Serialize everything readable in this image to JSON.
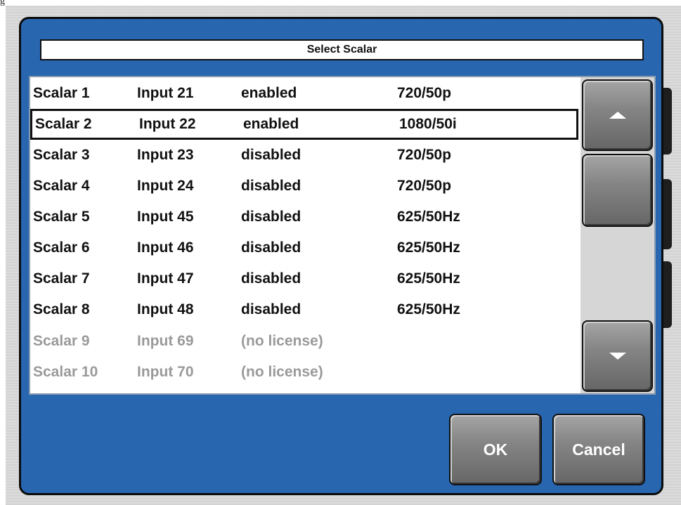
{
  "page_label": "g",
  "dialog": {
    "title": "Select Scalar",
    "rows": [
      {
        "name": "Scalar 1",
        "input": "Input 21",
        "status": "enabled",
        "format": "720/50p",
        "selected": false,
        "licensed": true
      },
      {
        "name": "Scalar 2",
        "input": "Input 22",
        "status": "enabled",
        "format": "1080/50i",
        "selected": true,
        "licensed": true
      },
      {
        "name": "Scalar 3",
        "input": "Input 23",
        "status": "disabled",
        "format": "720/50p",
        "selected": false,
        "licensed": true
      },
      {
        "name": "Scalar 4",
        "input": "Input 24",
        "status": "disabled",
        "format": "720/50p",
        "selected": false,
        "licensed": true
      },
      {
        "name": "Scalar 5",
        "input": "Input 45",
        "status": "disabled",
        "format": "625/50Hz",
        "selected": false,
        "licensed": true
      },
      {
        "name": "Scalar 6",
        "input": "Input 46",
        "status": "disabled",
        "format": "625/50Hz",
        "selected": false,
        "licensed": true
      },
      {
        "name": "Scalar 7",
        "input": "Input 47",
        "status": "disabled",
        "format": "625/50Hz",
        "selected": false,
        "licensed": true
      },
      {
        "name": "Scalar 8",
        "input": "Input 48",
        "status": "disabled",
        "format": "625/50Hz",
        "selected": false,
        "licensed": true
      },
      {
        "name": "Scalar 9",
        "input": "Input 69",
        "status": "(no license)",
        "format": "",
        "selected": false,
        "licensed": false
      },
      {
        "name": "Scalar 10",
        "input": "Input 70",
        "status": "(no license)",
        "format": "",
        "selected": false,
        "licensed": false
      }
    ],
    "scrollbar": {
      "up_icon": "chevron-up-icon",
      "down_icon": "chevron-down-icon"
    },
    "buttons": {
      "ok_label": "OK",
      "cancel_label": "Cancel"
    }
  },
  "colors": {
    "dialog_bg": "#2866b0",
    "list_bg": "#ffffff",
    "disabled_text": "#9a9a9a",
    "button_gray": "#858585"
  }
}
